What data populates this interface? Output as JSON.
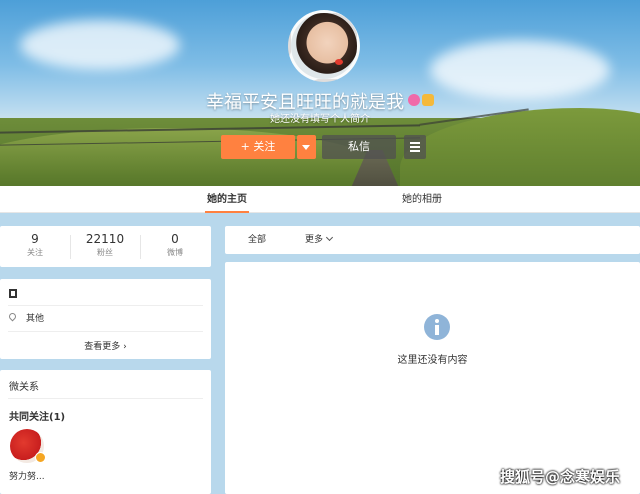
{
  "profile": {
    "nickname": "幸福平安且旺旺的就是我",
    "bio": "她还没有填写个人简介",
    "follow_label": "+ 关注",
    "message_label": "私信"
  },
  "tabs": [
    {
      "label": "她的主页",
      "active": true
    },
    {
      "label": "她的相册",
      "active": false
    }
  ],
  "stats": [
    {
      "value": "9",
      "label": "关注"
    },
    {
      "value": "22110",
      "label": "粉丝"
    },
    {
      "value": "0",
      "label": "微博"
    }
  ],
  "info": {
    "location": "其他",
    "more_label": "查看更多 ›"
  },
  "relations": {
    "title": "微关系",
    "common_follow_label": "共同关注(1)",
    "user_name": "努力努..."
  },
  "feed": {
    "filter_all": "全部",
    "filter_more": "更多",
    "empty_text": "这里还没有内容"
  },
  "watermark": "搜狐号@念寒娱乐",
  "colors": {
    "accent": "#ff8140",
    "page_bg": "#b8d8ec"
  }
}
